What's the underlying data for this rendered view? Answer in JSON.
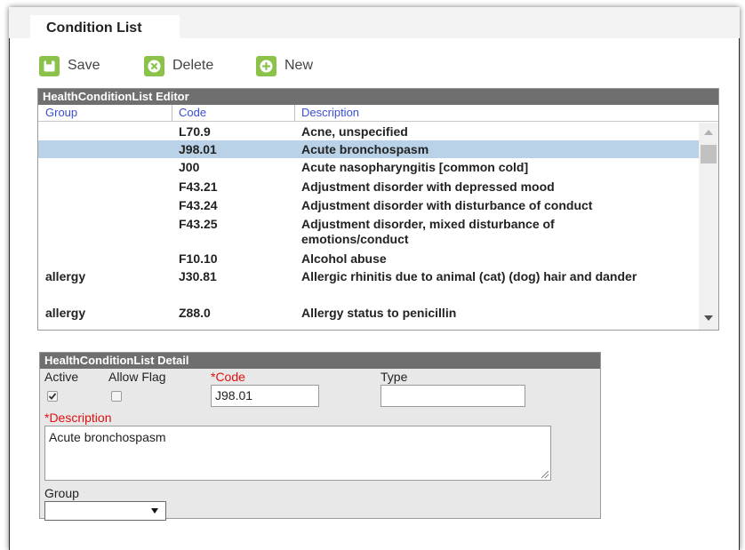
{
  "tab": {
    "label": "Condition List"
  },
  "toolbar": {
    "save_label": "Save",
    "delete_label": "Delete",
    "new_label": "New"
  },
  "editor": {
    "title": "HealthConditionList Editor",
    "columns": [
      "Group",
      "Code",
      "Description"
    ],
    "rows": [
      {
        "group": "",
        "code": "L70.9",
        "description": "Acne, unspecified"
      },
      {
        "group": "",
        "code": "J98.01",
        "description": "Acute bronchospasm",
        "selected": true
      },
      {
        "group": "",
        "code": "J00",
        "description": "Acute nasopharyngitis [common cold]"
      },
      {
        "group": "",
        "code": "F43.21",
        "description": "Adjustment disorder with depressed mood"
      },
      {
        "group": "",
        "code": "F43.24",
        "description": "Adjustment disorder with disturbance of conduct"
      },
      {
        "group": "",
        "code": "F43.25",
        "description": "Adjustment disorder, mixed disturbance of emotions/conduct"
      },
      {
        "group": "",
        "code": "F10.10",
        "description": "Alcohol abuse"
      },
      {
        "group": "allergy",
        "code": "J30.81",
        "description": "Allergic rhinitis due to animal (cat) (dog) hair and dander"
      },
      {
        "group": "allergy",
        "code": "Z88.0",
        "description": "Allergy status to penicillin"
      }
    ]
  },
  "detail": {
    "title": "HealthConditionList Detail",
    "active_label": "Active",
    "active_checked": true,
    "allow_flag_label": "Allow Flag",
    "allow_flag_checked": false,
    "code_label": "*Code",
    "code_value": "J98.01",
    "type_label": "Type",
    "type_value": "",
    "description_label": "*Description",
    "description_value": "Acute bronchospasm",
    "group_label": "Group",
    "group_value": ""
  },
  "colors": {
    "accent_green": "#8bc34a",
    "header_gray": "#6f6f6f",
    "link_blue": "#3a4fd6",
    "required_red": "#e01010",
    "selected_row": "#b9d2e8"
  }
}
